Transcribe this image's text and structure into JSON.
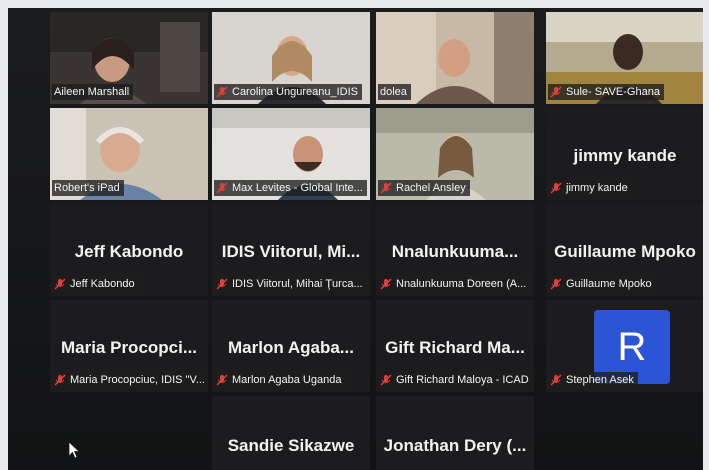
{
  "participants": [
    {
      "label": "Aileen Marshall",
      "muted": false,
      "active": true
    },
    {
      "label": "Carolina Ungureanu_IDIS",
      "muted": true
    },
    {
      "label": "dolea",
      "muted": false
    },
    {
      "label": "Sule- SAVE-Ghana",
      "muted": true
    },
    {
      "label": "Robert's iPad",
      "muted": false
    },
    {
      "label": "Max Levites - Global Inte...",
      "muted": true
    },
    {
      "label": "Rachel Ansley",
      "muted": true
    },
    {
      "name": "jimmy kande",
      "label": "jimmy kande",
      "muted": true
    },
    {
      "name": "Jeff Kabondo",
      "label": "Jeff Kabondo",
      "muted": true
    },
    {
      "name": "IDIS Viitorul, Mi...",
      "label": "IDIS Viitorul, Mihai Ţurca...",
      "muted": true
    },
    {
      "name": "Nnalunkuuma...",
      "label": "Nnalunkuuma Doreen (A...",
      "muted": true
    },
    {
      "name": "Guillaume Mpoko",
      "label": "Guillaume Mpoko",
      "muted": true
    },
    {
      "name": "Maria Procopci...",
      "label": "Maria Procopciuc, IDIS \"V...",
      "muted": true
    },
    {
      "name": "Marlon Agaba...",
      "label": "Marlon Agaba Uganda",
      "muted": true
    },
    {
      "name": "Gift Richard Ma...",
      "label": "Gift Richard Maloya - ICAD",
      "muted": true
    },
    {
      "avatar_letter": "R",
      "label": "Stephen Asek",
      "muted": true
    },
    {
      "name": "Sandie Sikazwe"
    },
    {
      "name": "Jonathan Dery (..."
    }
  ],
  "colors": {
    "active_speaker": "#c9d84a",
    "muted_icon": "#e0403a",
    "avatar_bg": "#2c55d6"
  },
  "icons": {
    "muted": "muted-mic-icon",
    "cursor": "mouse-pointer-icon"
  }
}
